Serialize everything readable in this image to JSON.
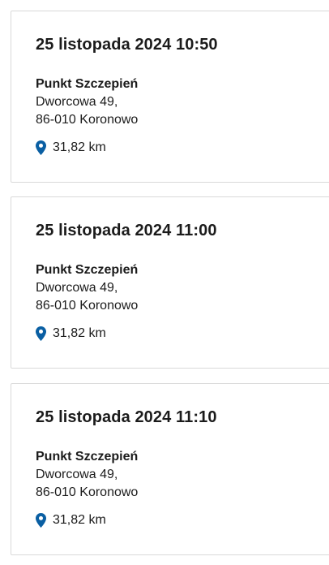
{
  "colors": {
    "pin": "#0a5fa3",
    "card_border": "#d9d9d9",
    "text": "#1b1b1b"
  },
  "slots": [
    {
      "datetime": "25 listopada 2024 10:50",
      "place_name": "Punkt Szczepień",
      "street": "Dworcowa 49,",
      "city": "86-010 Koronowo",
      "distance_icon": "location-pin-icon",
      "distance": "31,82 km"
    },
    {
      "datetime": "25 listopada 2024 11:00",
      "place_name": "Punkt Szczepień",
      "street": "Dworcowa 49,",
      "city": "86-010 Koronowo",
      "distance_icon": "location-pin-icon",
      "distance": "31,82 km"
    },
    {
      "datetime": "25 listopada 2024 11:10",
      "place_name": "Punkt Szczepień",
      "street": "Dworcowa 49,",
      "city": "86-010 Koronowo",
      "distance_icon": "location-pin-icon",
      "distance": "31,82 km"
    }
  ]
}
